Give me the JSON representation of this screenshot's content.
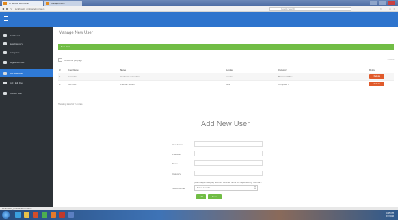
{
  "browser": {
    "tabs": [
      {
        "label": "CI Nimbus & UI Admin"
      },
      {
        "label": "Manage Users"
      }
    ],
    "url": "localhost/ci_nimbus/admin/users",
    "search_placeholder": "Google Search",
    "window_controls": [
      "minimize-icon",
      "maximize-icon",
      "close-icon"
    ]
  },
  "colors": {
    "header": "#2e74cd",
    "sidebar": "#2d3237",
    "sidebar_active": "#2f7ad6",
    "success": "#71bd45",
    "danger": "#e05a2b"
  },
  "sidebar": {
    "items": [
      {
        "label": "Dashboard",
        "icon": "dashboard-icon"
      },
      {
        "label": "New Category",
        "icon": "folder-icon"
      },
      {
        "label": "Categories",
        "icon": "list-icon"
      },
      {
        "label": "Registered User",
        "icon": "user-icon"
      },
      {
        "label": "Add New User",
        "icon": "user-plus-icon",
        "active": true
      },
      {
        "label": "Add / Edit Files",
        "icon": "file-icon"
      },
      {
        "label": "Website Task",
        "icon": "task-icon"
      }
    ]
  },
  "main": {
    "title": "Manage New User",
    "success_message": "New User",
    "entries_label": "10  records per page",
    "search_label": "Search:",
    "table": {
      "columns": [
        "#",
        "User Name",
        "Name",
        "Gender",
        "Category",
        "Delete"
      ],
      "rows": [
        {
          "num": "1",
          "username": "Candidate",
          "name": "Candidate Candidate",
          "gender": "Female",
          "category": "Business Office",
          "delete_label": "Delete"
        },
        {
          "num": "2",
          "username": "Test User",
          "name": "Friendly Student",
          "gender": "Male",
          "category": "Computer IT",
          "delete_label": "Delete"
        }
      ]
    },
    "table_info": "Showing 1 to 2 of 2 entries"
  },
  "form": {
    "title": "Add New User",
    "fields": [
      {
        "label": "User Name",
        "value": ""
      },
      {
        "label": "Password",
        "value": ""
      },
      {
        "label": "Name",
        "value": ""
      },
      {
        "label": "Category",
        "value": ""
      }
    ],
    "category_hint": "(For multiple category hold ctrl, selected items are separated by \"comma\")",
    "gender_label": "Select Gender",
    "gender_value": "Select Gender",
    "add_button": "Add",
    "reset_button": "Reset"
  },
  "status_bar": "localhost/ci_nimbus/admin/users",
  "taskbar": {
    "icons": [
      "start-icon",
      "ie-icon",
      "folder-icon",
      "media-icon",
      "chrome-icon",
      "firefox-icon",
      "photoshop-icon",
      "app-icon"
    ],
    "time": "4:45 PM",
    "date": "6/7/2015"
  }
}
